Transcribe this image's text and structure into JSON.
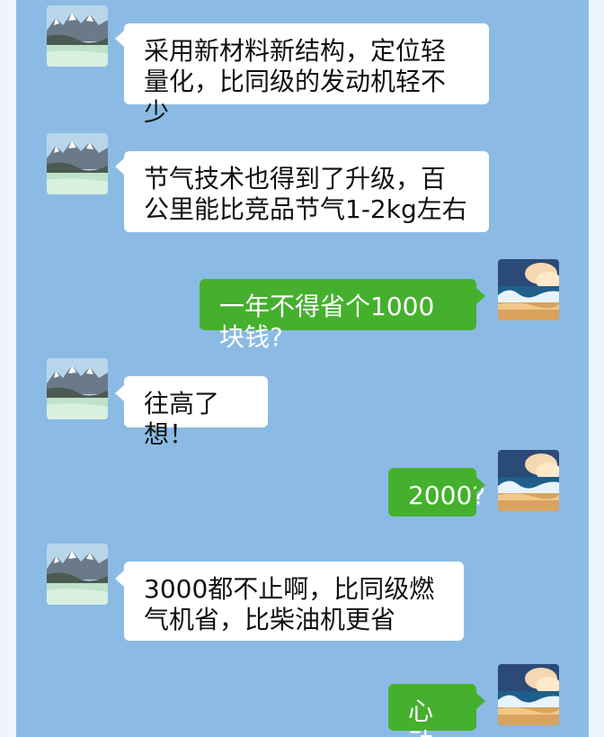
{
  "messages": [
    {
      "from": "left",
      "text": "采用新材料新结构，定位轻量化，比同级的发动机轻不少"
    },
    {
      "from": "left",
      "text": "节气技术也得到了升级，百公里能比竞品节气1-2kg左右"
    },
    {
      "from": "right",
      "text": "一年不得省个1000块钱?"
    },
    {
      "from": "left",
      "text": "往高了想！"
    },
    {
      "from": "right",
      "text": "2000?"
    },
    {
      "from": "left",
      "text": "3000都不止啊，比同级燃气机省，比柴油机更省"
    },
    {
      "from": "right",
      "text": "心动了"
    }
  ],
  "colors": {
    "chat_background": "#8bbbe4",
    "incoming_bubble": "#ffffff",
    "outgoing_bubble": "#45b02e"
  },
  "avatars": {
    "left": "mountain-lake-avatar",
    "right": "ocean-wave-avatar"
  }
}
